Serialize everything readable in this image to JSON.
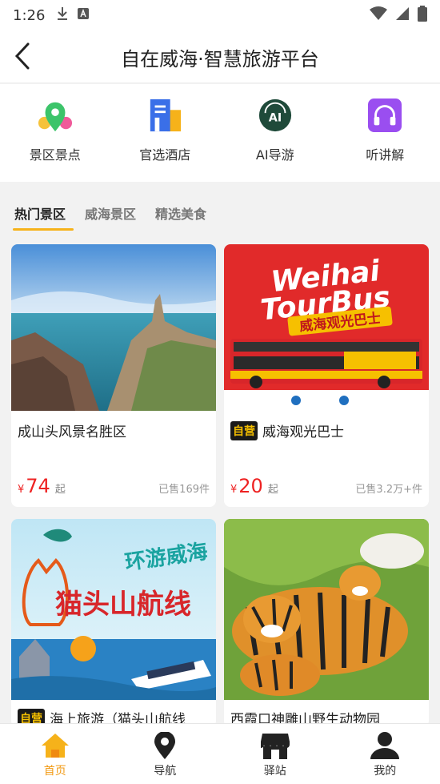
{
  "status": {
    "time": "1:26"
  },
  "appbar": {
    "title": "自在威海·智慧旅游平台"
  },
  "quick_menu": [
    {
      "label": "景区景点",
      "icon": "map-pin-icon"
    },
    {
      "label": "官选酒店",
      "icon": "hotel-icon"
    },
    {
      "label": "AI导游",
      "icon": "ai-guide-icon"
    },
    {
      "label": "听讲解",
      "icon": "headphones-icon"
    }
  ],
  "tabs": [
    {
      "label": "热门景区",
      "active": true
    },
    {
      "label": "威海景区",
      "active": false
    },
    {
      "label": "精选美食",
      "active": false
    }
  ],
  "cards": [
    {
      "title": "成山头风景名胜区",
      "badge": "",
      "yen": "¥",
      "price": "74",
      "qi": "起",
      "sold": "已售169件"
    },
    {
      "title": "威海观光巴士",
      "badge": "自营",
      "yen": "¥",
      "price": "20",
      "qi": "起",
      "sold": "已售3.2万+件",
      "image_text": {
        "brand1": "Weihai",
        "brand2": "TourBus",
        "cn": "威海观光巴士"
      }
    },
    {
      "title": "海上旅游（猫头山航线",
      "badge": "自营",
      "image_text": {
        "line1": "环游威海",
        "line2": "猫头山航线"
      }
    },
    {
      "title": "西霞口神雕山野生动物园",
      "badge": ""
    }
  ],
  "bottom_nav": [
    {
      "label": "首页",
      "active": true
    },
    {
      "label": "导航",
      "active": false
    },
    {
      "label": "驿站",
      "active": false
    },
    {
      "label": "我的",
      "active": false
    }
  ],
  "colors": {
    "accent": "#f29a14",
    "price": "#ee2222",
    "tab_underline": "#f6b21a"
  }
}
